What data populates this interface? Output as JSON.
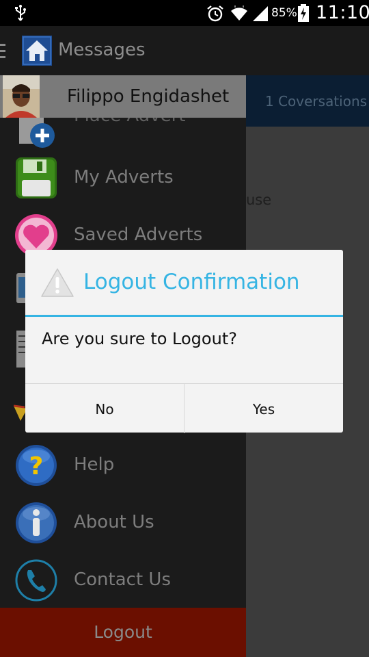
{
  "status_bar": {
    "battery_percent": "85%",
    "time": "11:10",
    "icons": [
      "usb-icon",
      "alarm-icon",
      "wifi-icon",
      "signal-icon",
      "battery-charging-icon"
    ]
  },
  "app_bar": {
    "title": "Messages",
    "icons": [
      "menu-icon",
      "home-icon"
    ]
  },
  "content": {
    "conversations_label": "1 Coversations",
    "snippet": "use"
  },
  "drawer": {
    "user_name": "Filippo Engidashet",
    "items": [
      {
        "label": "Place Advert",
        "icon": "place-advert-icon"
      },
      {
        "label": "My Adverts",
        "icon": "floppy-disk-icon"
      },
      {
        "label": "Saved Adverts",
        "icon": "heart-icon"
      },
      {
        "label": "",
        "icon": "phone-device-icon"
      },
      {
        "label": "",
        "icon": "document-icon"
      },
      {
        "label": "",
        "icon": "star-icon"
      },
      {
        "label": "Help",
        "icon": "help-icon"
      },
      {
        "label": "About Us",
        "icon": "info-icon"
      },
      {
        "label": "Contact Us",
        "icon": "phone-icon"
      }
    ],
    "logout_label": "Logout"
  },
  "dialog": {
    "title": "Logout Confirmation",
    "message": "Are you sure to Logout?",
    "no_label": "No",
    "yes_label": "Yes",
    "icon": "warning-icon"
  },
  "colors": {
    "accent": "#35b4e3",
    "logout_bg": "#6b0f00",
    "drawer_bg": "#1b1b1b"
  }
}
